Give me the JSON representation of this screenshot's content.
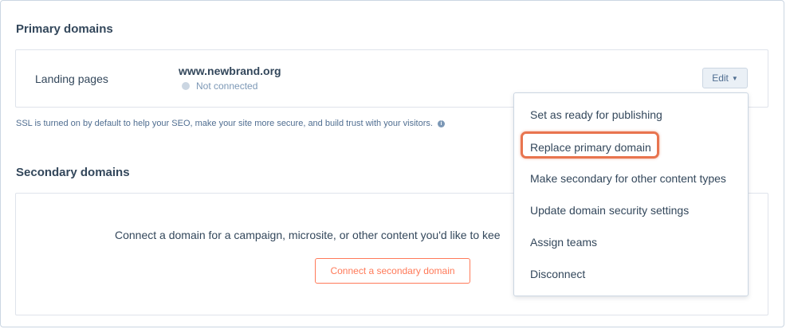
{
  "primary": {
    "title": "Primary domains",
    "row_label": "Landing pages",
    "domain": "www.newbrand.org",
    "status": "Not connected",
    "edit_label": "Edit",
    "ssl_note": "SSL is turned on by default to help your SEO, make your site more secure, and build trust with your visitors.",
    "info_icon": "i"
  },
  "secondary": {
    "title": "Secondary domains",
    "connect_text": "Connect a domain for a campaign, microsite, or other content you'd like to kee",
    "connect_button": "Connect a secondary domain"
  },
  "menu": {
    "items": [
      "Set as ready for publishing",
      "Replace primary domain",
      "Make secondary for other content types",
      "Update domain security settings",
      "Assign teams",
      "Disconnect"
    ],
    "highlighted_item": "Replace primary domain",
    "highlight_color": "#e8744f"
  },
  "colors": {
    "accent": "#ff7a59",
    "text": "#33475b",
    "muted": "#7c98b6"
  }
}
